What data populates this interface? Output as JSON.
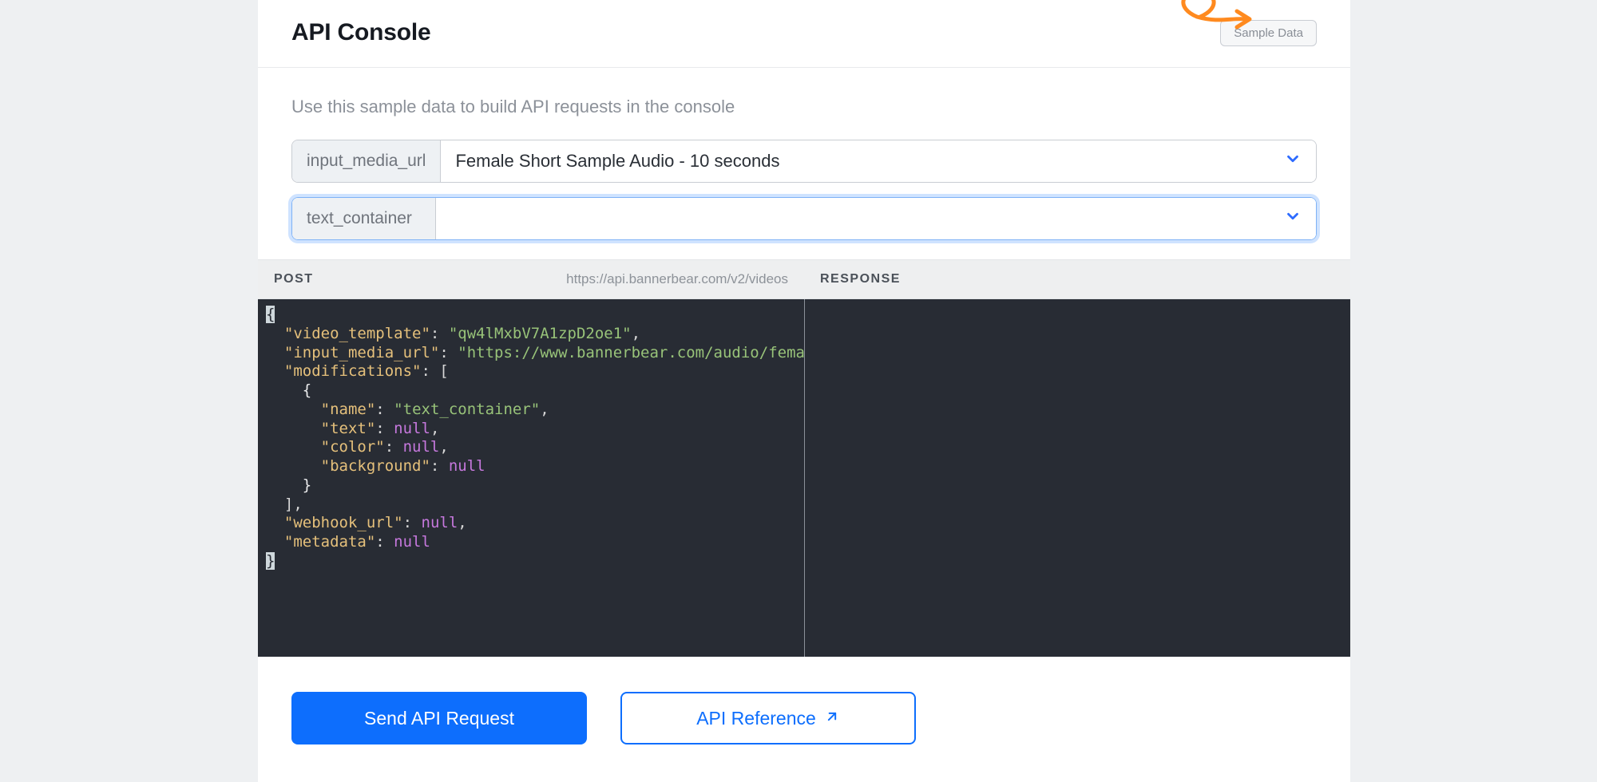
{
  "header": {
    "title": "API Console",
    "sample_button": "Sample Data"
  },
  "intro_text": "Use this sample data to build API requests in the console",
  "fields": {
    "media": {
      "label": "input_media_url",
      "value": "Female Short Sample Audio - 10 seconds"
    },
    "text_container": {
      "label": "text_container",
      "value": ""
    }
  },
  "codebar": {
    "post": "POST",
    "endpoint": "https://api.bannerbear.com/v2/videos",
    "response": "RESPONSE"
  },
  "request_body": {
    "video_template": "qw4lMxbV7A1zpD2oe1",
    "input_media_url": "https://www.bannerbear.com/audio/female_sh",
    "mod_name": "text_container",
    "keys": {
      "video_template": "\"video_template\"",
      "input_media_url": "\"input_media_url\"",
      "modifications": "\"modifications\"",
      "name": "\"name\"",
      "text": "\"text\"",
      "color": "\"color\"",
      "background": "\"background\"",
      "webhook_url": "\"webhook_url\"",
      "metadata": "\"metadata\""
    }
  },
  "actions": {
    "send": "Send API Request",
    "ref": "API Reference"
  }
}
